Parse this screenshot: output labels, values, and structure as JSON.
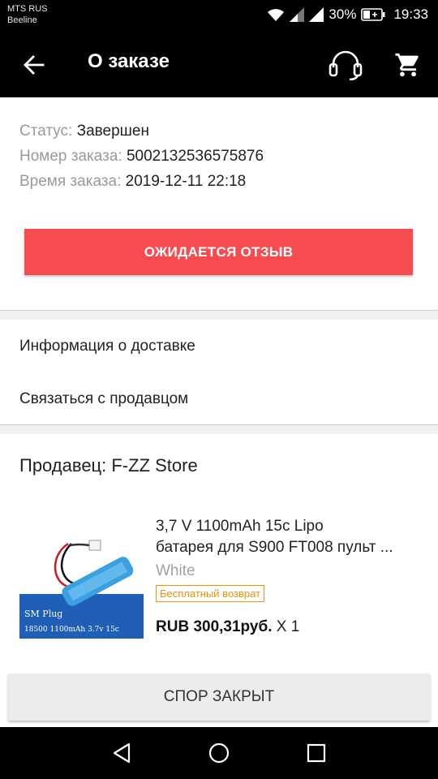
{
  "status_bar": {
    "carrier_1": "MTS RUS",
    "carrier_2": "Beeline",
    "battery": "30%",
    "time": "19:33"
  },
  "app_bar": {
    "title": "О заказе",
    "icons": [
      "back-arrow-icon",
      "headset-icon",
      "cart-icon"
    ]
  },
  "order": {
    "status_label": "Статус:",
    "status_value": "Завершен",
    "number_label": "Номер заказа:",
    "number_value": "5002132536575876",
    "time_label": "Время заказа:",
    "time_value": "2019-12-11 22:18"
  },
  "review_button": "ОЖИДАЕТСЯ ОТЗЫВ",
  "links": {
    "delivery_info": "Информация о доставке",
    "contact_seller": "Связаться с продавцом"
  },
  "seller": "Продавец: F-ZZ Store",
  "product": {
    "title_line1": "3,7 V 1100mAh 15c Lipo",
    "title_line2": "батарея для S900 FT008 пульт ...",
    "variant": "White",
    "badge": "Бесплатный возврат",
    "price": "RUB 300,31руб.",
    "quantity": "X 1",
    "image_text_1": "SM Plug",
    "image_text_2": "18500 1100mAh 3.7v 15c"
  },
  "dispute_button": "СПОР ЗАКРЫТ",
  "colors": {
    "accent": "#f64c50",
    "badge": "#e8930c",
    "bar": "#000000"
  }
}
